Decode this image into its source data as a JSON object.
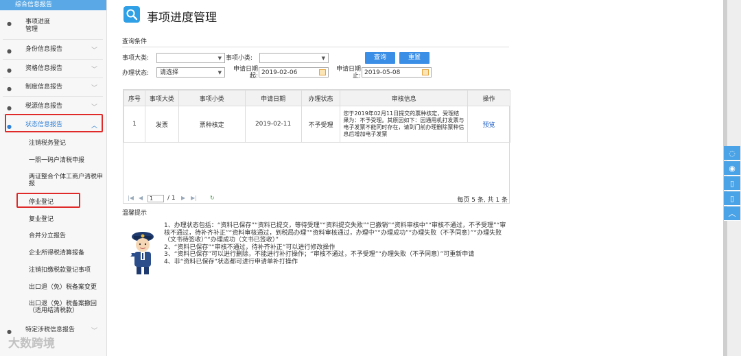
{
  "sidebar": {
    "top_label": "综合信息报告",
    "items": [
      {
        "label": "事项进度\n管理",
        "chevron": ""
      },
      {
        "label": "身份信息报告",
        "chevron": "﹀"
      },
      {
        "label": "资格信息报告",
        "chevron": "﹀"
      },
      {
        "label": "制度信息报告",
        "chevron": "﹀"
      },
      {
        "label": "税源信息报告",
        "chevron": "﹀"
      },
      {
        "label": "状态信息报告",
        "chevron": "︿"
      }
    ],
    "subitems": [
      "注销税务登记",
      "一照一码户清税申报",
      "两证整合个体工商户清税申报",
      "停业登记",
      "复业登记",
      "合并分立报告",
      "企业所得税清算报备",
      "注销扣缴税款登记事项",
      "出口退（免）税备案变更",
      "出口退（免）税备案撤回（适用结清税款）"
    ],
    "bottom_item": {
      "label": "特定涉税信息报告",
      "chevron": "﹀"
    }
  },
  "main": {
    "title": "事项进度管理",
    "query_title": "查询条件",
    "form": {
      "major_label": "事项大类:",
      "major_value": "",
      "minor_label": "事项小类:",
      "minor_value": "",
      "status_label": "办理状态:",
      "status_value": "请选择",
      "start_label": "申请日期起:",
      "start_value": "2019-02-06",
      "end_label": "申请日期止:",
      "end_value": "2019-05-08",
      "query_button": "查询",
      "reset_button": "重置"
    },
    "table": {
      "headers": [
        "序号",
        "事项大类",
        "事项小类",
        "申请日期",
        "办理状态",
        "审核信息",
        "操作"
      ],
      "rows": [
        {
          "no": "1",
          "major": "发票",
          "minor": "票种核定",
          "date": "2019-02-11",
          "status": "不予受理",
          "message": "您于2019年02月11日提交的票种核定，受理结果为：不予受理。其原因如下：因通用机打发票与电子发票不能同时存在，请到门前办理删除票种信息后增加电子发票",
          "action": "预览"
        }
      ]
    },
    "pager": {
      "page_value": "1",
      "total_pages": "/ 1",
      "summary": "每页 5 条, 共 1 条"
    },
    "tips_title": "温馨提示",
    "tips": [
      "1、办理状态包括：“资料已保存”“资料已提交，等待受理”“资料提交失败”“已撤销”“资料审核中”“审核不通过，不予受理”“审核不通过，待补齐补正”“资料审核通过，到税局办理”“资料审核通过，办理中”“办理成功”“办理失败（不予同意）”“办理失败（文书待签收）”“办理成功（文书已签收）”",
      "2、“资料已保存”“审核不通过，待补齐补正”可以进行修改操作",
      "3、“资料已保存”可以进行删除，不能进行补打操作；“审核不通过，不予受理”“办理失败（不予同意）”可重新申请",
      "4、非“资料已保存”状态都可进行申请单补打操作"
    ]
  },
  "watermark": "大数跨境",
  "colors": {
    "accent": "#3a8ee6",
    "highlight": "#e02a2a",
    "link": "#1f5fc7"
  }
}
